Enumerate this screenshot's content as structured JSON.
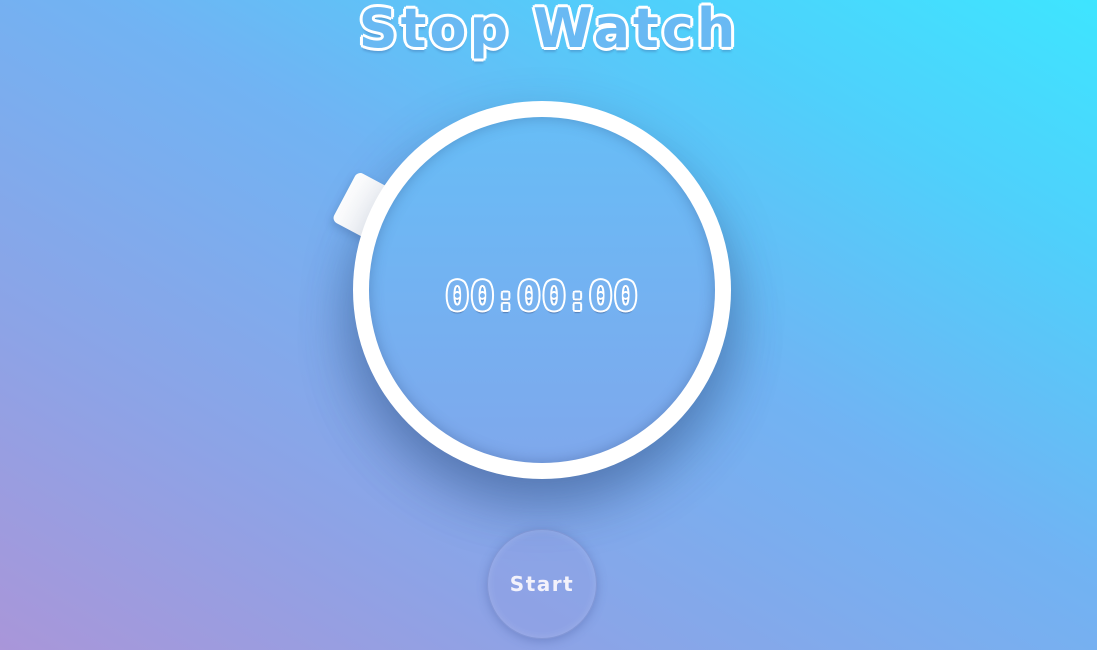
{
  "header": {
    "title": "Stop Watch"
  },
  "stopwatch": {
    "hours": "00",
    "minutes": "00",
    "seconds": "00",
    "separator": ":"
  },
  "controls": {
    "start_label": "Start"
  },
  "colors": {
    "background_start": "#a996d9",
    "background_end": "#3ee5ff",
    "ring": "#ffffff",
    "face_top": "#67bdf6",
    "face_bottom": "#7fa8ec",
    "text": "#ffffff"
  }
}
